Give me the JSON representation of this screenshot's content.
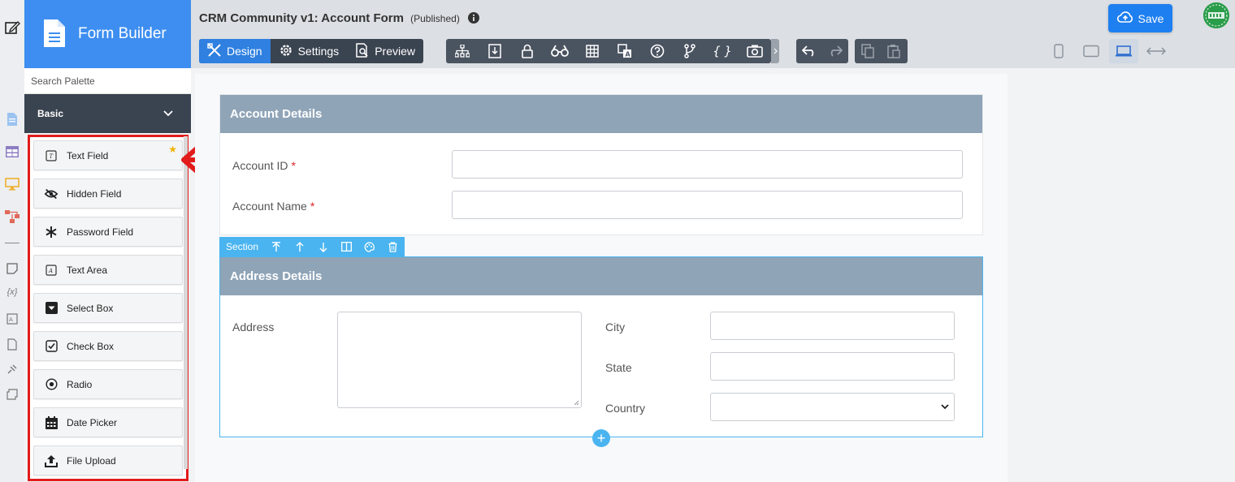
{
  "brand": {
    "title": "Form Builder"
  },
  "palette": {
    "search_placeholder": "Search Palette",
    "group_label": "Basic",
    "items": [
      {
        "label": "Text Field",
        "icon": "text-field-icon"
      },
      {
        "label": "Hidden Field",
        "icon": "eye-slash-icon"
      },
      {
        "label": "Password Field",
        "icon": "asterisk-icon"
      },
      {
        "label": "Text Area",
        "icon": "text-area-icon"
      },
      {
        "label": "Select Box",
        "icon": "select-box-icon"
      },
      {
        "label": "Check Box",
        "icon": "check-box-icon"
      },
      {
        "label": "Radio",
        "icon": "radio-icon"
      },
      {
        "label": "Date Picker",
        "icon": "calendar-icon"
      },
      {
        "label": "File Upload",
        "icon": "upload-icon"
      }
    ]
  },
  "header": {
    "form_title": "CRM Community v1: Account Form",
    "status": "(Published)",
    "tabs": [
      {
        "label": "Design",
        "icon": "design-icon",
        "active": true
      },
      {
        "label": "Settings",
        "icon": "gear-icon",
        "active": false
      },
      {
        "label": "Preview",
        "icon": "preview-icon",
        "active": false
      }
    ],
    "save_label": "Save"
  },
  "form": {
    "section1": {
      "title": "Account Details",
      "fields": [
        {
          "label": "Account ID",
          "required_mark": "*"
        },
        {
          "label": "Account Name",
          "required_mark": "*"
        }
      ]
    },
    "section_toolbar_label": "Section",
    "section2": {
      "title": "Address Details",
      "address_label": "Address",
      "city_label": "City",
      "state_label": "State",
      "country_label": "Country"
    }
  },
  "colors": {
    "accent": "#3d8ef0",
    "panel_header": "#8fa4b7",
    "highlight_border": "#e21b1b",
    "section_toolbar": "#4ab4f0"
  }
}
